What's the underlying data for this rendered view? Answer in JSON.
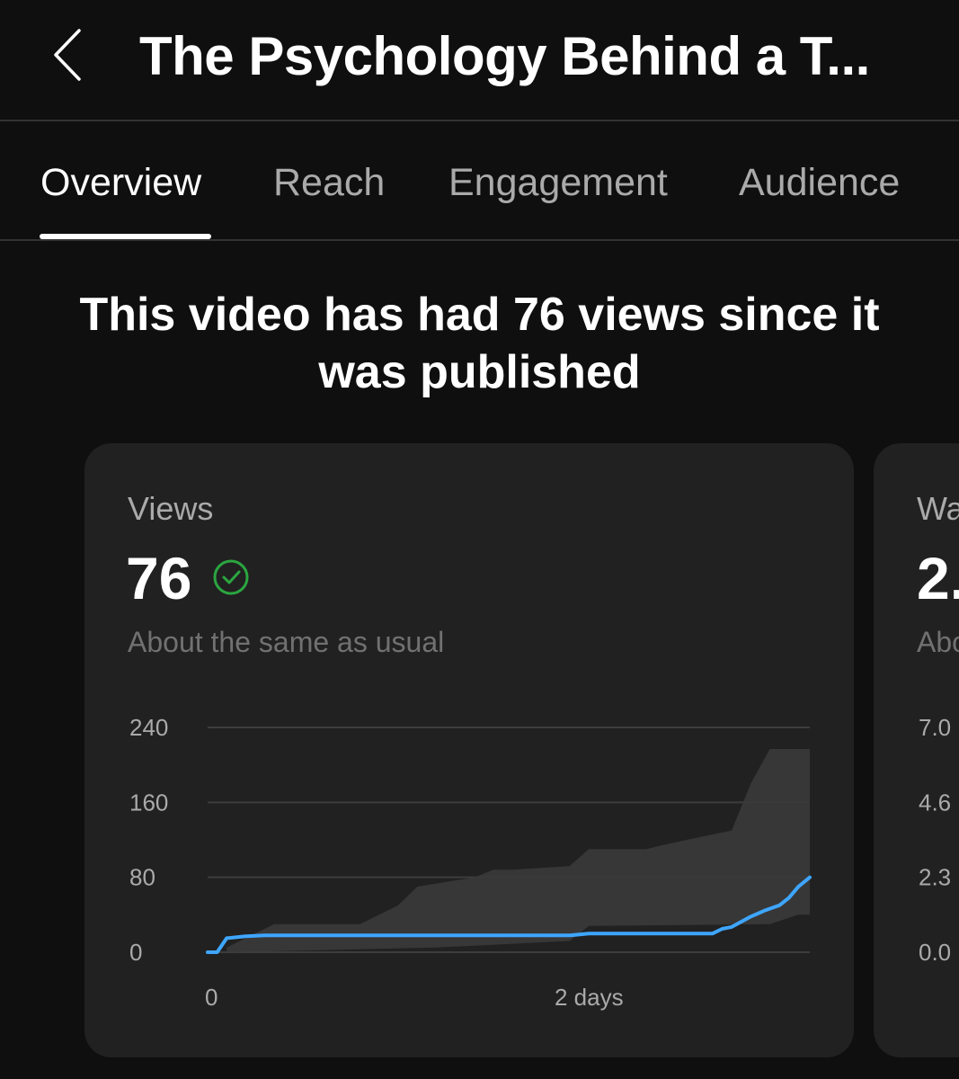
{
  "header": {
    "back_label": "Back",
    "title": "The Psychology Behind a T..."
  },
  "tabs": [
    {
      "label": "Overview",
      "active": true
    },
    {
      "label": "Reach",
      "active": false
    },
    {
      "label": "Engagement",
      "active": false
    },
    {
      "label": "Audience",
      "active": false
    }
  ],
  "headline": "This video has had 76 views since it was published",
  "views_card": {
    "label": "Views",
    "value": "76",
    "status_icon": "check-circle-icon",
    "comparison": "About the same as usual"
  },
  "next_card": {
    "label": "Wa",
    "value": "2.",
    "comparison": "Abo",
    "y_ticks": [
      "7.0",
      "4.6",
      "2.3",
      "0.0"
    ]
  },
  "colors": {
    "background": "#0f0f0f",
    "card": "#212121",
    "line": "#3ea6ff",
    "band": "#3a3a3a",
    "check": "#2ba640"
  },
  "chart_data": {
    "type": "line",
    "title": "",
    "xlabel": "",
    "ylabel": "",
    "y_ticks": [
      "240",
      "160",
      "80",
      "0"
    ],
    "x_tick_labels": [
      "0",
      "2 days"
    ],
    "ylim": [
      0,
      240
    ],
    "xlim_days": [
      0,
      3.16
    ],
    "grid": true,
    "series": [
      {
        "role": "views",
        "x_days": [
          0,
          0.05,
          0.1,
          0.2,
          0.3,
          0.5,
          1.0,
          1.5,
          1.9,
          2.0,
          2.5,
          2.65,
          2.7,
          2.75,
          2.85,
          2.93,
          3.0,
          3.05,
          3.1,
          3.16
        ],
        "values": [
          0,
          0,
          15,
          17,
          18,
          18,
          18,
          18,
          18,
          20,
          20,
          20,
          25,
          27,
          38,
          45,
          50,
          58,
          70,
          80
        ]
      },
      {
        "role": "typical_range_upper",
        "x_days": [
          0.1,
          0.35,
          0.8,
          0.9,
          1.0,
          1.1,
          1.4,
          1.5,
          1.6,
          1.9,
          2.0,
          2.3,
          2.4,
          2.75,
          2.85,
          2.95,
          3.16
        ],
        "values": [
          5,
          30,
          30,
          40,
          50,
          70,
          80,
          88,
          88,
          92,
          110,
          110,
          115,
          130,
          180,
          217,
          217
        ]
      },
      {
        "role": "typical_range_lower",
        "x_days": [
          0.1,
          1.2,
          1.9,
          2.0,
          2.95,
          3.1,
          3.16
        ],
        "values": [
          0,
          5,
          12,
          28,
          30,
          40,
          40
        ]
      }
    ]
  }
}
